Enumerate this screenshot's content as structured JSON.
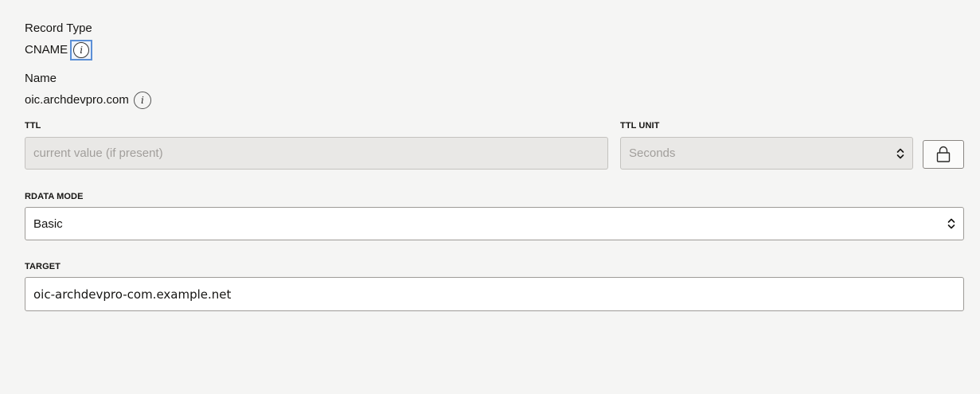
{
  "record_type": {
    "label": "Record Type",
    "value": "CNAME"
  },
  "name": {
    "label": "Name",
    "value": "oic.archdevpro.com"
  },
  "ttl": {
    "label": "TTL",
    "placeholder": "current value (if present)"
  },
  "ttl_unit": {
    "label": "TTL UNIT",
    "value": "Seconds"
  },
  "rdata_mode": {
    "label": "RDATA MODE",
    "value": "Basic"
  },
  "target": {
    "label": "TARGET",
    "value": "oic-archdevpro-com.example.net"
  },
  "icons": {
    "info": "info-icon",
    "lock": "lock-icon",
    "select": "chevron-up-down-icon"
  },
  "colors": {
    "background": "#f5f5f4",
    "focus": "#5b8fd6",
    "disabled_field": "#e9e8e6"
  }
}
